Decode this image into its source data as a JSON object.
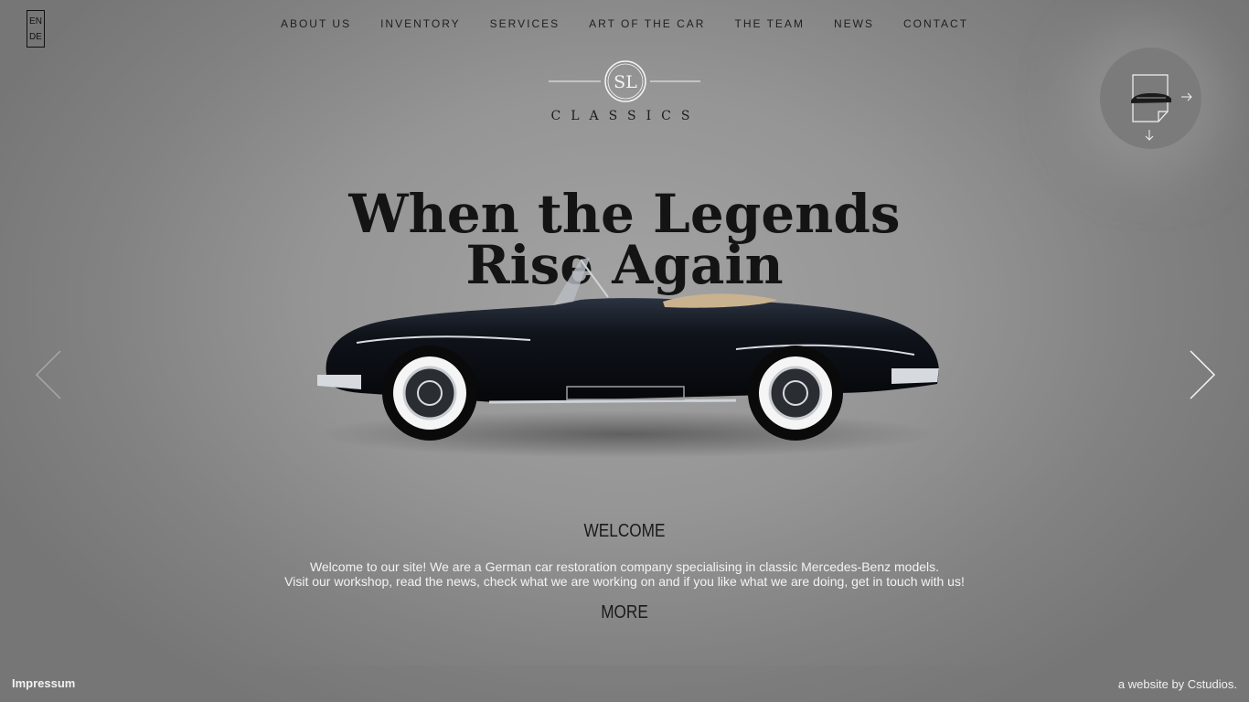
{
  "language_switch": {
    "options": [
      "EN",
      "DE"
    ],
    "selected": "EN"
  },
  "nav": {
    "items": [
      {
        "label": "ABOUT US"
      },
      {
        "label": "INVENTORY"
      },
      {
        "label": "SERVICES"
      },
      {
        "label": "ART OF THE CAR"
      },
      {
        "label": "THE TEAM"
      },
      {
        "label": "NEWS"
      },
      {
        "label": "CONTACT"
      }
    ]
  },
  "logo": {
    "monogram": "SL",
    "wordmark": "CLASSICS"
  },
  "hero": {
    "title_line1": "When the Legends",
    "title_line2": "Rise Again"
  },
  "slider": {
    "prev_icon": "chevron-left-icon",
    "next_icon": "chevron-right-icon"
  },
  "badge": {
    "icon": "document-car-icon",
    "arrows": [
      "arrow-right-icon",
      "arrow-down-icon"
    ]
  },
  "welcome": {
    "heading": "WELCOME",
    "line1": "Welcome to our site! We are a German car restoration company specialising in classic Mercedes-Benz models.",
    "line2": "Visit our workshop, read the news, check what we are working on and if you like what we are doing, get in touch with us!",
    "more_label": "MORE"
  },
  "footer": {
    "impressum": "Impressum",
    "credit_prefix": "a website by ",
    "credit_link": "Cstudios",
    "credit_suffix": "."
  },
  "colors": {
    "text_dark": "#1a1a1a",
    "text_light": "#f2f2f2",
    "background": "#959595"
  }
}
